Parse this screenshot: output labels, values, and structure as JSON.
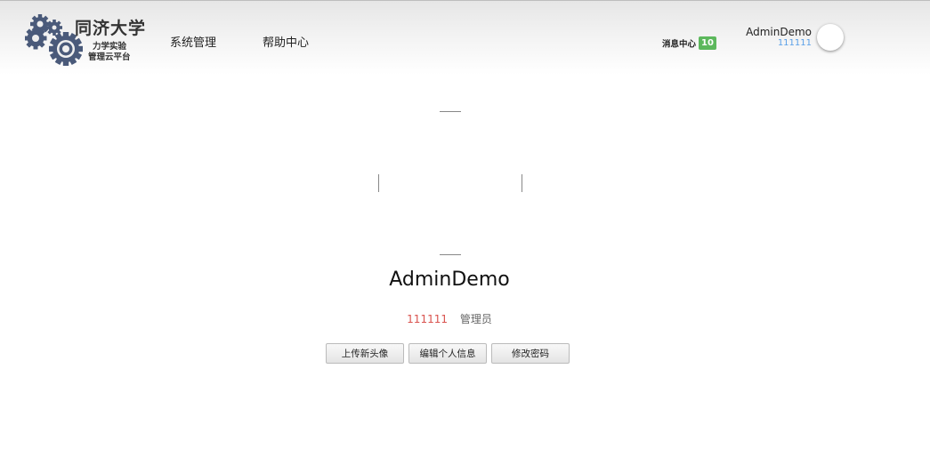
{
  "header": {
    "logo": {
      "title": "同济大学",
      "subtitle_line1": "力学实验",
      "subtitle_line2": "管理云平台",
      "gear_color": "#4a5a7a"
    },
    "nav": [
      {
        "label": "系统管理"
      },
      {
        "label": "帮助中心"
      }
    ],
    "messages": {
      "label": "消息中心",
      "count": "10",
      "badge_color": "#5cb85c"
    },
    "user": {
      "name": "AdminDemo",
      "id": "111111"
    }
  },
  "profile": {
    "name": "AdminDemo",
    "id": "111111",
    "role": "管理员",
    "id_color": "#d9534f",
    "buttons": {
      "upload_avatar": "上传新头像",
      "edit_info": "编辑个人信息",
      "change_password": "修改密码"
    }
  }
}
